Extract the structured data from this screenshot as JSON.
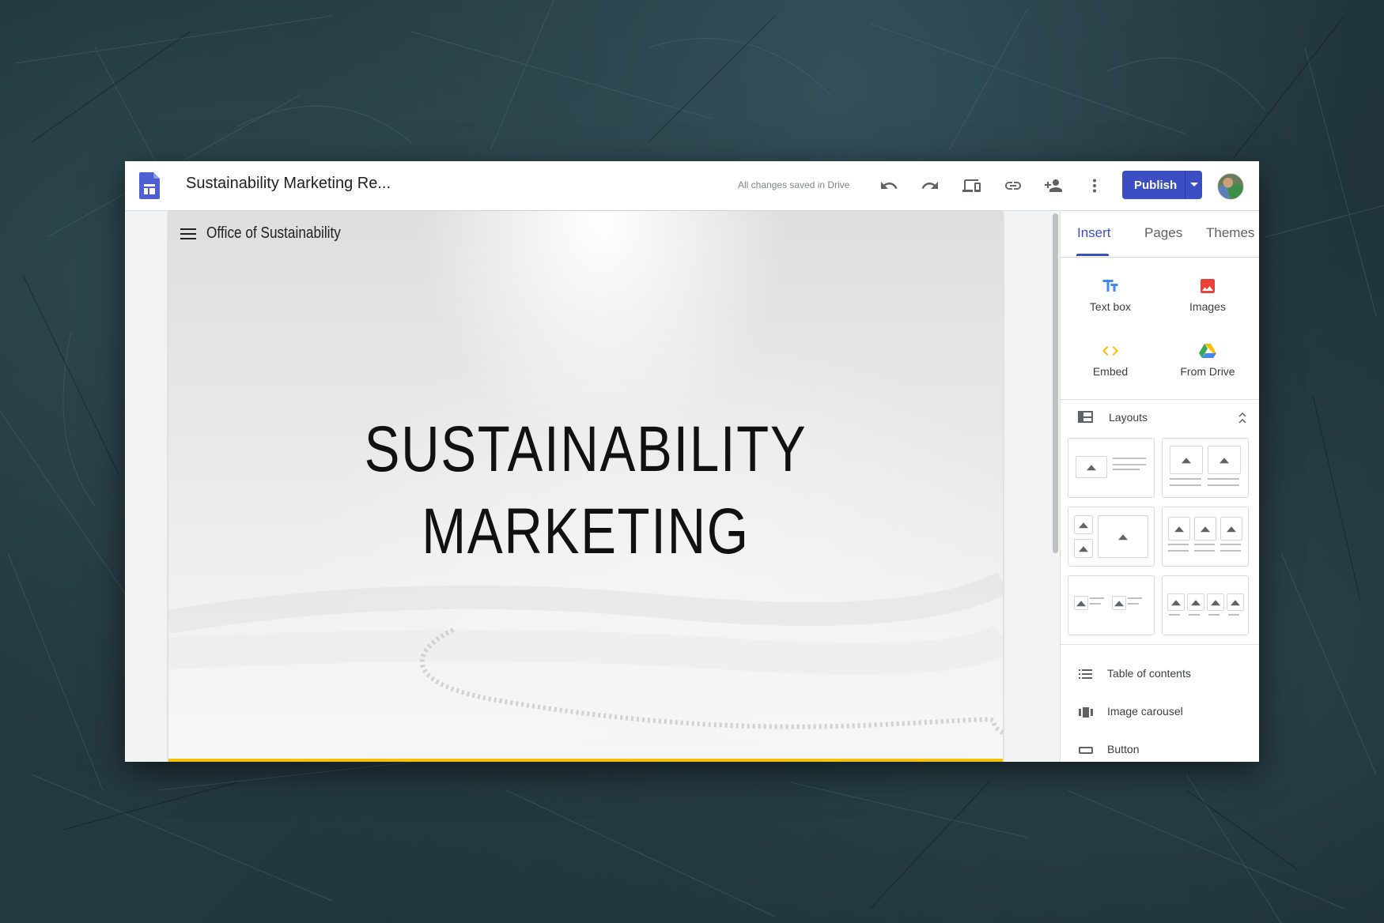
{
  "app": {
    "doc_title": "Sustainability Marketing Re...",
    "save_status": "All changes saved in Drive",
    "publish_label": "Publish",
    "toolbar_icons": [
      "undo-icon",
      "redo-icon",
      "preview-devices-icon",
      "link-icon",
      "share-add-person-icon",
      "more-vert-icon"
    ]
  },
  "site": {
    "name": "Office of Sustainability",
    "hero_title_line1": "SUSTAINABILITY",
    "hero_title_line2": "MARKETING",
    "accent_color": "#f4c20d"
  },
  "panel": {
    "tabs": [
      {
        "label": "Insert",
        "active": true
      },
      {
        "label": "Pages",
        "active": false
      },
      {
        "label": "Themes",
        "active": false
      }
    ],
    "insert_items": [
      {
        "label": "Text box",
        "icon": "text-box-icon",
        "color": "#4285f4"
      },
      {
        "label": "Images",
        "icon": "image-icon",
        "color": "#ea4335"
      },
      {
        "label": "Embed",
        "icon": "embed-code-icon",
        "color": "#fbbc04"
      },
      {
        "label": "From Drive",
        "icon": "google-drive-icon",
        "color": "#34a853"
      }
    ],
    "layouts_label": "Layouts",
    "list_items": [
      {
        "label": "Table of contents",
        "icon": "toc-list-icon"
      },
      {
        "label": "Image carousel",
        "icon": "carousel-icon"
      },
      {
        "label": "Button",
        "icon": "button-outline-icon"
      }
    ]
  },
  "colors": {
    "primary": "#3b4ec4",
    "text": "#202124"
  }
}
